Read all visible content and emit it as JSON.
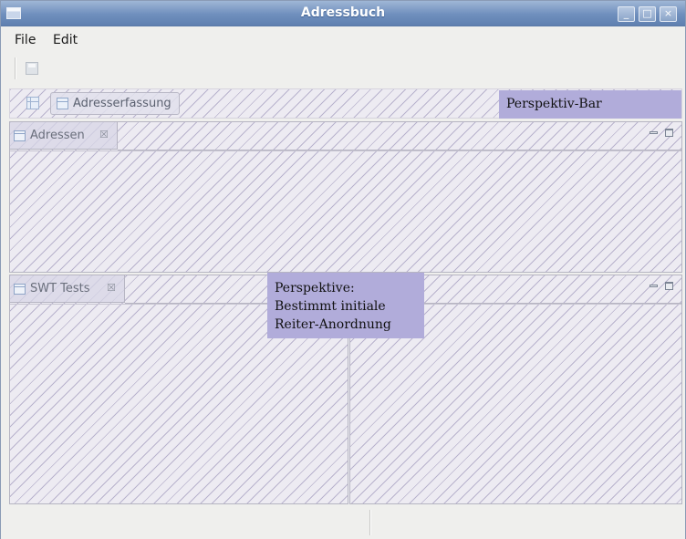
{
  "window": {
    "title": "Adressbuch"
  },
  "menubar": {
    "items": [
      {
        "label": "File"
      },
      {
        "label": "Edit"
      }
    ]
  },
  "toolbar": {
    "save_icon": "save-icon"
  },
  "perspective_bar": {
    "open_perspective_icon": "open-perspective-icon",
    "active_perspective": "Adresserfassung"
  },
  "views": {
    "top": {
      "tab_label": "Adressen",
      "close_glyph": "☒"
    },
    "bottom": {
      "tab_label": "SWT Tests",
      "close_glyph": "☒"
    }
  },
  "annotations": {
    "perspective_bar_note": "Perspektiv-Bar",
    "perspective_note": {
      "line1": "Perspektive:",
      "line2": "Bestimmt initiale",
      "line3": "Reiter-Anordnung"
    }
  },
  "colors": {
    "annotation_bg": "#b1acda",
    "titlebar": "#6f8fbd",
    "hatch": "#786ea0"
  }
}
